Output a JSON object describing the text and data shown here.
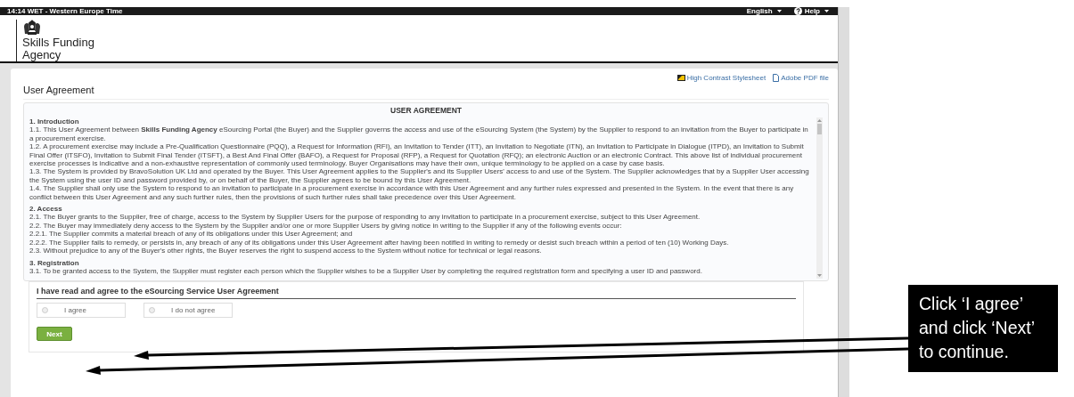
{
  "top_bar": {
    "time": "14:14 WET - Western Europe Time",
    "language": "English",
    "help": "Help"
  },
  "logo": {
    "lines": [
      "Skills Funding",
      "Agency"
    ]
  },
  "links": [
    {
      "label": "High Contrast Stylesheet",
      "kind": "contrast"
    },
    {
      "label": "Adobe PDF file",
      "kind": "pdf"
    }
  ],
  "page_title": "User Agreement",
  "agreement": {
    "title": "USER AGREEMENT",
    "sections": [
      {
        "heading": "1. Introduction",
        "paragraphs": [
          "1.1. This User Agreement between **Skills Funding Agency** eSourcing Portal (the Buyer) and the Supplier governs the access and use of the eSourcing System (the System) by the Supplier to respond to an invitation from the Buyer to participate in a procurement exercise.",
          "1.2. A procurement exercise may include a Pre-Qualification Questionnaire (PQQ), a Request for Information (RFI), an Invitation to Tender (ITT), an Invitation to Negotiate (ITN), an Invitation to Participate in Dialogue (ITPD), an Invitation to Submit Final Offer (ITSFO), Invitation to Submit Final Tender (ITSFT), a Best And Final Offer (BAFO), a Request for Proposal (RFP), a Request for Quotation (RFQ); an electronic Auction or an electronic Contract. This above list of individual procurement exercise processes is indicative and a non-exhaustive representation of commonly used terminology. Buyer Organisations may have their own, unique terminology to be applied on a case by case basis.",
          "1.3. The System is provided by BravoSolution UK Ltd and operated by the Buyer. This User Agreement applies to the Supplier's and its Supplier Users' access to and use of the System. The Supplier acknowledges that by a Supplier User accessing the System using the user ID and password provided by, or on behalf of the Buyer, the Supplier agrees to be bound by this User Agreement.",
          "1.4. The Supplier shall only use the System to respond to an invitation to participate in a procurement exercise in accordance with this User Agreement and any further rules expressed and presented in the System. In the event that there is any conflict between this User Agreement and any such further rules, then the provisions of such further rules shall take precedence over this User Agreement."
        ]
      },
      {
        "heading": "2. Access",
        "paragraphs": [
          "2.1. The Buyer grants to the Supplier, free of charge, access to the System by Supplier Users for the purpose of responding to any invitation to participate in a procurement exercise, subject to this User Agreement.",
          "2.2. The Buyer may immediately deny access to the System by the Supplier and/or one or more Supplier Users by giving notice in writing to the Supplier if any of the following events occur:",
          "2.2.1. The Supplier commits a material breach of any of its obligations under this User Agreement; and",
          "2.2.2. The Supplier fails to remedy, or persists in, any breach of any of its obligations under this User Agreement after having been notified in writing to remedy or desist such breach within a period of ten (10) Working Days.",
          "2.3. Without prejudice to any of the Buyer's other rights, the Buyer reserves the right to suspend access to the System without notice for technical or legal reasons."
        ]
      },
      {
        "heading": "3. Registration",
        "paragraphs": [
          "3.1. To be granted access to the System, the Supplier must register each person which the Supplier wishes to be a Supplier User by completing the required registration form and specifying a user ID and password."
        ]
      }
    ]
  },
  "consent": {
    "heading": "I have read and agree to the eSourcing Service User Agreement",
    "options": [
      {
        "label": "I agree",
        "selected": false
      },
      {
        "label": "I do not agree",
        "selected": false
      }
    ],
    "button": "Next"
  },
  "callout": {
    "text": "Click ‘I agree’ and click ‘Next’ to continue."
  }
}
